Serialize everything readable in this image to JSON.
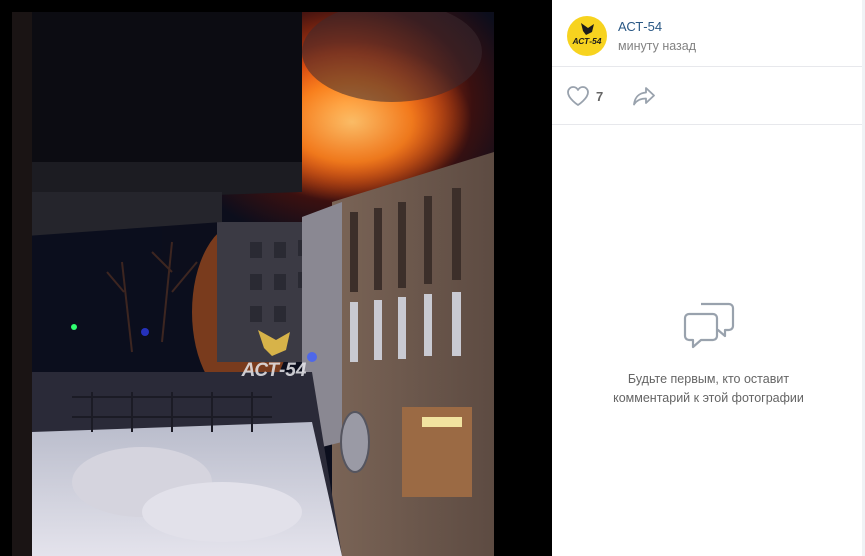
{
  "post": {
    "author": "АСТ-54",
    "time": "минуту назад",
    "avatar_text": "АСТ-54",
    "watermark_text": "АСТ-54"
  },
  "actions": {
    "likes_count": "7",
    "like_icon": "heart-icon",
    "share_icon": "share-arrow-icon"
  },
  "comments": {
    "empty_line1": "Будьте первым, кто оставит",
    "empty_line2": "комментарий к этой фотографии",
    "empty_icon": "comments-icon"
  },
  "colors": {
    "author_link": "#2a5885",
    "avatar_bg": "#f7d31f",
    "muted": "#828282",
    "icon": "#99a2ad"
  }
}
